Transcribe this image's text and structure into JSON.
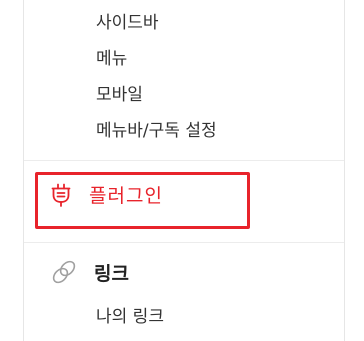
{
  "menu": {
    "sub_items_top": [
      {
        "label": "사이드바"
      },
      {
        "label": "메뉴"
      },
      {
        "label": "모바일"
      },
      {
        "label": "메뉴바/구독 설정"
      }
    ],
    "plugin": {
      "label": "플러그인",
      "icon": "plug-icon",
      "highlighted": true
    },
    "link": {
      "label": "링크",
      "icon": "link-icon"
    },
    "link_sub_items": [
      {
        "label": "나의 링크"
      }
    ]
  },
  "colors": {
    "highlight": "#e8232b",
    "text": "#333333",
    "icon_gray": "#9a9a9a"
  }
}
